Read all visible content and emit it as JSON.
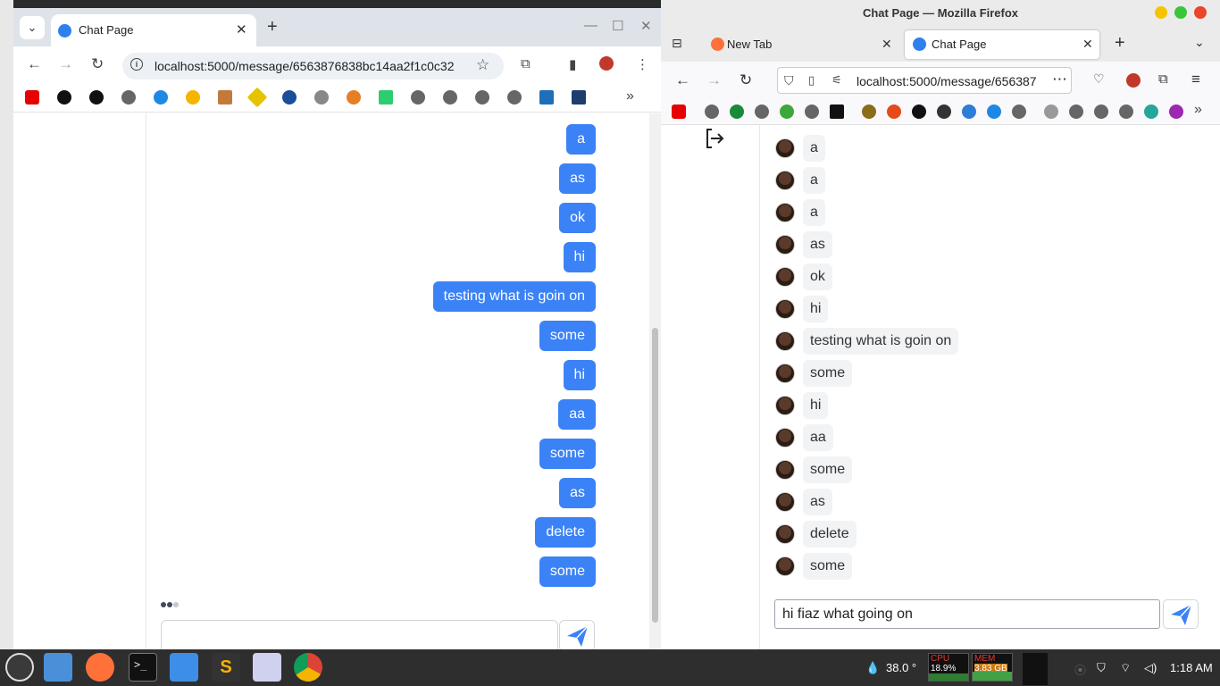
{
  "chrome": {
    "tab_title": "Chat Page",
    "url": "localhost:5000/message/6563876838bc14aa2f1c0c32",
    "sent_messages": [
      "a",
      "as",
      "ok",
      "hi",
      "testing what is goin on",
      "some",
      "hi",
      "aa",
      "some",
      "as",
      "delete",
      "some"
    ],
    "input_value": ""
  },
  "firefox": {
    "window_title": "Chat Page — Mozilla Firefox",
    "tabs": [
      {
        "label": "New Tab"
      },
      {
        "label": "Chat Page"
      }
    ],
    "url": "localhost:5000/message/656387",
    "received_messages": [
      "a",
      "a",
      "a",
      "as",
      "ok",
      "hi",
      "testing what is goin on",
      "some",
      "hi",
      "aa",
      "some",
      "as",
      "delete",
      "some"
    ],
    "input_value": "hi fiaz what going on"
  },
  "taskbar": {
    "temperature": "38.0 °",
    "cpu_label": "CPU",
    "cpu_value": "18.9%",
    "mem_label": "MEM",
    "mem_value": "3.83 GB",
    "clock": "1:18 AM"
  },
  "colors": {
    "accent_blue": "#3b82f6",
    "received_bubble": "#f1f3f5"
  }
}
